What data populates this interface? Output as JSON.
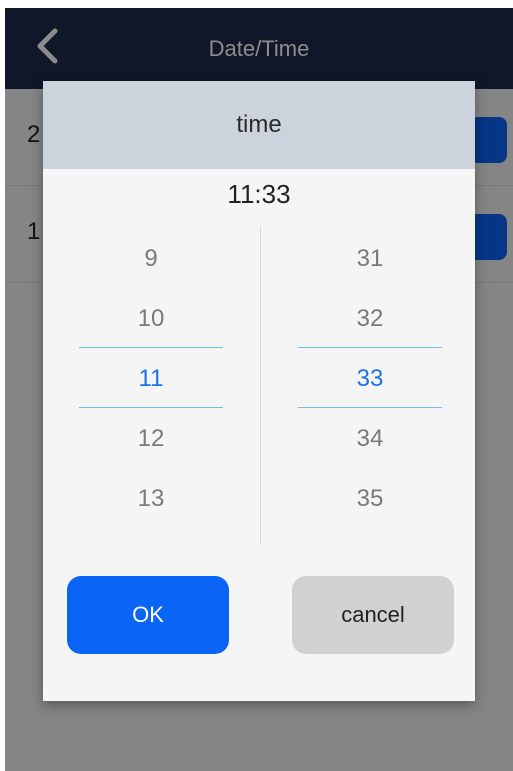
{
  "topbar": {
    "title": "Date/Time"
  },
  "rows": [
    {
      "value_partial": "2"
    },
    {
      "value_partial": "1"
    }
  ],
  "dialog": {
    "title": "time",
    "current_time": "11:33",
    "hours": [
      "9",
      "10",
      "11",
      "12",
      "13"
    ],
    "minutes": [
      "31",
      "32",
      "33",
      "34",
      "35"
    ],
    "selected_hour": "11",
    "selected_minute": "33",
    "ok_label": "OK",
    "cancel_label": "cancel"
  },
  "colors": {
    "topbar_bg": "#1c2a4a",
    "accent": "#0a64f5",
    "selected_text": "#1a73e8",
    "dialog_header_bg": "#ccd3dc",
    "cancel_bg": "#d1d1d1"
  },
  "icons": {
    "back": "chevron-left-icon"
  }
}
